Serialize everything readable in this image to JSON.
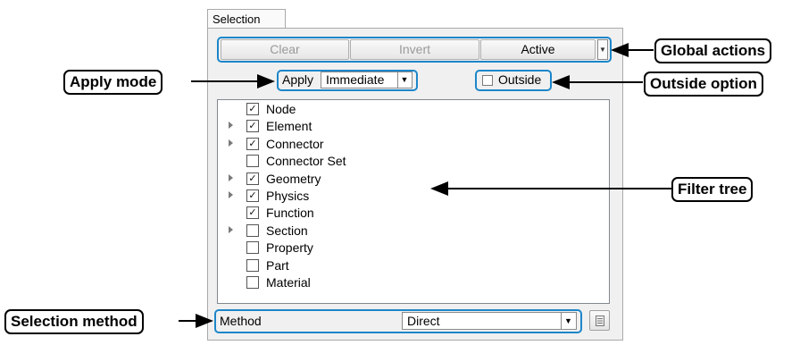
{
  "tab": {
    "label": "Selection"
  },
  "actions": {
    "clear": "Clear",
    "invert": "Invert",
    "active": "Active"
  },
  "apply": {
    "label": "Apply",
    "mode": "Immediate"
  },
  "outside": {
    "label": "Outside",
    "checked": false
  },
  "tree": [
    {
      "label": "Node",
      "checked": true,
      "expandable": false
    },
    {
      "label": "Element",
      "checked": true,
      "expandable": true
    },
    {
      "label": "Connector",
      "checked": true,
      "expandable": true
    },
    {
      "label": "Connector Set",
      "checked": false,
      "expandable": false
    },
    {
      "label": "Geometry",
      "checked": true,
      "expandable": true
    },
    {
      "label": "Physics",
      "checked": true,
      "expandable": true
    },
    {
      "label": "Function",
      "checked": true,
      "expandable": false
    },
    {
      "label": "Section",
      "checked": false,
      "expandable": true
    },
    {
      "label": "Property",
      "checked": false,
      "expandable": false
    },
    {
      "label": "Part",
      "checked": false,
      "expandable": false
    },
    {
      "label": "Material",
      "checked": false,
      "expandable": false
    }
  ],
  "method": {
    "label": "Method",
    "value": "Direct"
  },
  "callouts": {
    "global_actions": "Global actions",
    "apply_mode": "Apply mode",
    "outside_option": "Outside option",
    "filter_tree": "Filter tree",
    "selection_method": "Selection method"
  },
  "colors": {
    "highlight": "#1c86c9",
    "panel_bg": "#f0f0f0"
  }
}
